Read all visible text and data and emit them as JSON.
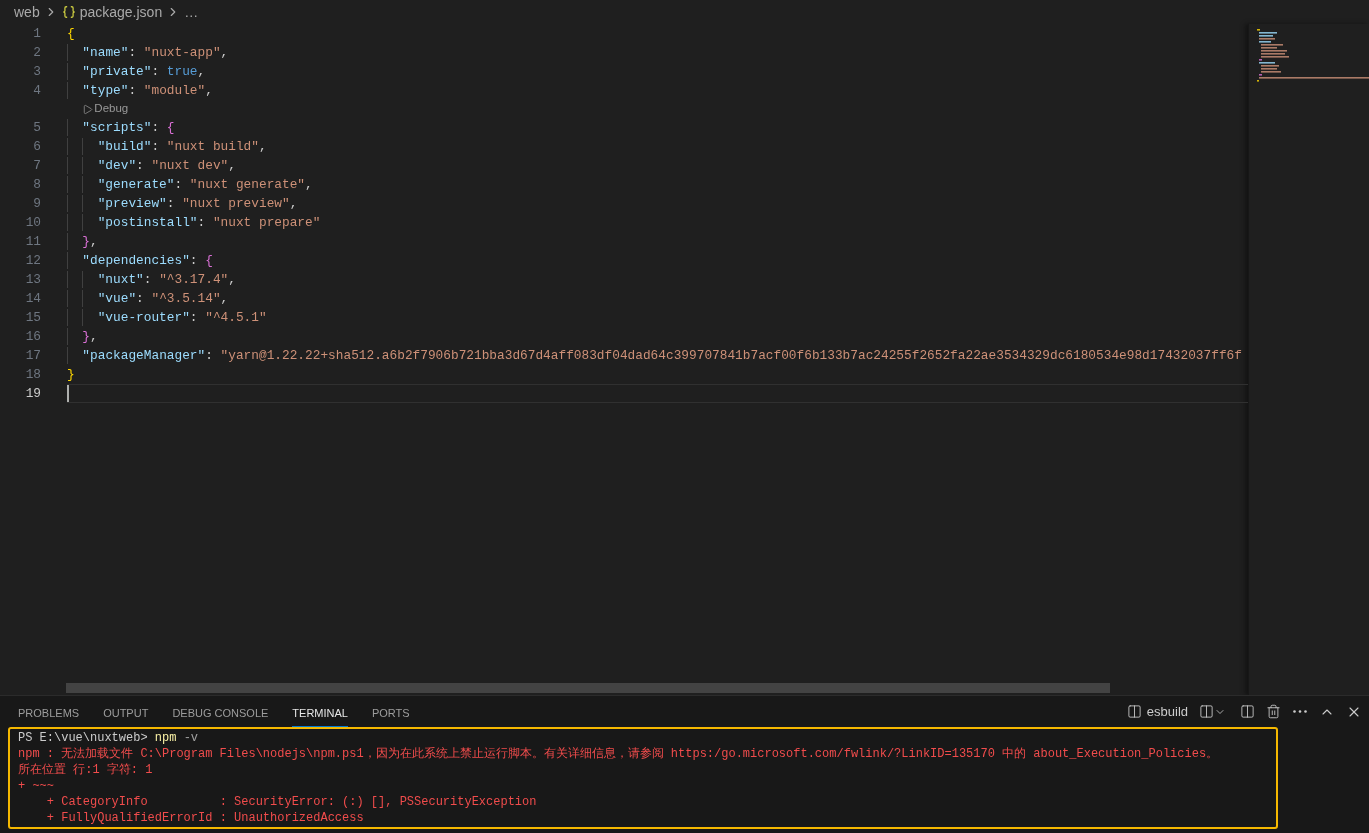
{
  "breadcrumb": {
    "items": [
      {
        "kind": "folder",
        "label": "web"
      },
      {
        "kind": "file",
        "label": "package.json"
      },
      {
        "kind": "symbol",
        "label": "…"
      }
    ]
  },
  "editor": {
    "lines": [
      {
        "kind": "code",
        "number": "1",
        "current": false,
        "tokens": [
          {
            "kind": "bracket1",
            "text": "{"
          }
        ],
        "children": [
          {
            "kind": "code",
            "number": "2",
            "current": false,
            "tokens": [
              {
                "kind": "key",
                "text": "\"name\""
              },
              {
                "kind": "punct",
                "text": ": "
              },
              {
                "kind": "string",
                "text": "\"nuxt-app\""
              },
              {
                "kind": "punct",
                "text": ","
              }
            ]
          },
          {
            "kind": "code",
            "number": "3",
            "current": false,
            "tokens": [
              {
                "kind": "key",
                "text": "\"private\""
              },
              {
                "kind": "punct",
                "text": ": "
              },
              {
                "kind": "keyword",
                "text": "true"
              },
              {
                "kind": "punct",
                "text": ","
              }
            ]
          },
          {
            "kind": "code",
            "number": "4",
            "current": false,
            "tokens": [
              {
                "kind": "key",
                "text": "\"type\""
              },
              {
                "kind": "punct",
                "text": ": "
              },
              {
                "kind": "string",
                "text": "\"module\""
              },
              {
                "kind": "punct",
                "text": ","
              }
            ]
          },
          {
            "kind": "codelens",
            "label": "Debug"
          },
          {
            "kind": "code",
            "number": "5",
            "current": false,
            "tokens": [
              {
                "kind": "key",
                "text": "\"scripts\""
              },
              {
                "kind": "punct",
                "text": ": "
              },
              {
                "kind": "bracket2",
                "text": "{"
              }
            ],
            "children": [
              {
                "kind": "code",
                "number": "6",
                "current": false,
                "tokens": [
                  {
                    "kind": "key",
                    "text": "\"build\""
                  },
                  {
                    "kind": "punct",
                    "text": ": "
                  },
                  {
                    "kind": "string",
                    "text": "\"nuxt build\""
                  },
                  {
                    "kind": "punct",
                    "text": ","
                  }
                ]
              },
              {
                "kind": "code",
                "number": "7",
                "current": false,
                "tokens": [
                  {
                    "kind": "key",
                    "text": "\"dev\""
                  },
                  {
                    "kind": "punct",
                    "text": ": "
                  },
                  {
                    "kind": "string",
                    "text": "\"nuxt dev\""
                  },
                  {
                    "kind": "punct",
                    "text": ","
                  }
                ]
              },
              {
                "kind": "code",
                "number": "8",
                "current": false,
                "tokens": [
                  {
                    "kind": "key",
                    "text": "\"generate\""
                  },
                  {
                    "kind": "punct",
                    "text": ": "
                  },
                  {
                    "kind": "string",
                    "text": "\"nuxt generate\""
                  },
                  {
                    "kind": "punct",
                    "text": ","
                  }
                ]
              },
              {
                "kind": "code",
                "number": "9",
                "current": false,
                "tokens": [
                  {
                    "kind": "key",
                    "text": "\"preview\""
                  },
                  {
                    "kind": "punct",
                    "text": ": "
                  },
                  {
                    "kind": "string",
                    "text": "\"nuxt preview\""
                  },
                  {
                    "kind": "punct",
                    "text": ","
                  }
                ]
              },
              {
                "kind": "code",
                "number": "10",
                "current": false,
                "tokens": [
                  {
                    "kind": "key",
                    "text": "\"postinstall\""
                  },
                  {
                    "kind": "punct",
                    "text": ": "
                  },
                  {
                    "kind": "string",
                    "text": "\"nuxt prepare\""
                  }
                ]
              }
            ]
          },
          {
            "kind": "code",
            "number": "11",
            "current": false,
            "tokens": [
              {
                "kind": "bracket2",
                "text": "}"
              },
              {
                "kind": "punct",
                "text": ","
              }
            ]
          },
          {
            "kind": "code",
            "number": "12",
            "current": false,
            "tokens": [
              {
                "kind": "key",
                "text": "\"dependencies\""
              },
              {
                "kind": "punct",
                "text": ": "
              },
              {
                "kind": "bracket2",
                "text": "{"
              }
            ],
            "children": [
              {
                "kind": "code",
                "number": "13",
                "current": false,
                "tokens": [
                  {
                    "kind": "key",
                    "text": "\"nuxt\""
                  },
                  {
                    "kind": "punct",
                    "text": ": "
                  },
                  {
                    "kind": "string",
                    "text": "\"^3.17.4\""
                  },
                  {
                    "kind": "punct",
                    "text": ","
                  }
                ]
              },
              {
                "kind": "code",
                "number": "14",
                "current": false,
                "tokens": [
                  {
                    "kind": "key",
                    "text": "\"vue\""
                  },
                  {
                    "kind": "punct",
                    "text": ": "
                  },
                  {
                    "kind": "string",
                    "text": "\"^3.5.14\""
                  },
                  {
                    "kind": "punct",
                    "text": ","
                  }
                ]
              },
              {
                "kind": "code",
                "number": "15",
                "current": false,
                "tokens": [
                  {
                    "kind": "key",
                    "text": "\"vue-router\""
                  },
                  {
                    "kind": "punct",
                    "text": ": "
                  },
                  {
                    "kind": "string",
                    "text": "\"^4.5.1\""
                  }
                ]
              }
            ]
          },
          {
            "kind": "code",
            "number": "16",
            "current": false,
            "tokens": [
              {
                "kind": "bracket2",
                "text": "}"
              },
              {
                "kind": "punct",
                "text": ","
              }
            ]
          },
          {
            "kind": "code",
            "number": "17",
            "current": false,
            "tokens": [
              {
                "kind": "key",
                "text": "\"packageManager\""
              },
              {
                "kind": "punct",
                "text": ": "
              },
              {
                "kind": "string",
                "text": "\"yarn@1.22.22+sha512.a6b2f7906b721bba3d67d4aff083df04dad64c399707841b7acf00f6b133b7ac24255f2652fa22ae3534329dc6180534e98d17432037ff6f"
              }
            ]
          }
        ]
      },
      {
        "kind": "code",
        "number": "18",
        "current": false,
        "tokens": [
          {
            "kind": "bracket1",
            "text": "}"
          }
        ]
      },
      {
        "kind": "code",
        "number": "19",
        "current": true
      }
    ]
  },
  "panel": {
    "tabs": [
      {
        "label": "PROBLEMS",
        "selected": false
      },
      {
        "label": "OUTPUT",
        "selected": false
      },
      {
        "label": "DEBUG CONSOLE",
        "selected": false
      },
      {
        "label": "TERMINAL",
        "selected": true
      },
      {
        "label": "PORTS",
        "selected": false
      }
    ],
    "terminal_name": "esbuild",
    "terminal_lines": [
      {
        "segments": [
          {
            "kind": "prompt",
            "text": "PS E:\\vue\\nuxtweb> "
          },
          {
            "kind": "command",
            "text": "npm"
          },
          {
            "kind": "parameter",
            "text": " -v"
          }
        ]
      },
      {
        "segments": [
          {
            "kind": "error",
            "text": "npm : 无法加载文件 C:\\Program Files\\nodejs\\npm.ps1，因为在此系统上禁止运行脚本。有关详细信息，请参阅 https:/go.microsoft.com/fwlink/?LinkID=135170 中的 about_Execution_Policies。"
          }
        ]
      },
      {
        "segments": [
          {
            "kind": "error",
            "text": "所在位置 行:1 字符: 1"
          }
        ]
      },
      {
        "segments": [
          {
            "kind": "error",
            "text": "+ ~~~"
          }
        ],
        "children": [
          {
            "segments": [
              {
                "kind": "error",
                "text": "+ CategoryInfo          : SecurityError: (:) [], PSSecurityException"
              }
            ]
          },
          {
            "segments": [
              {
                "kind": "error",
                "text": "+ FullyQualifiedErrorId : UnauthorizedAccess"
              }
            ]
          }
        ]
      }
    ]
  }
}
